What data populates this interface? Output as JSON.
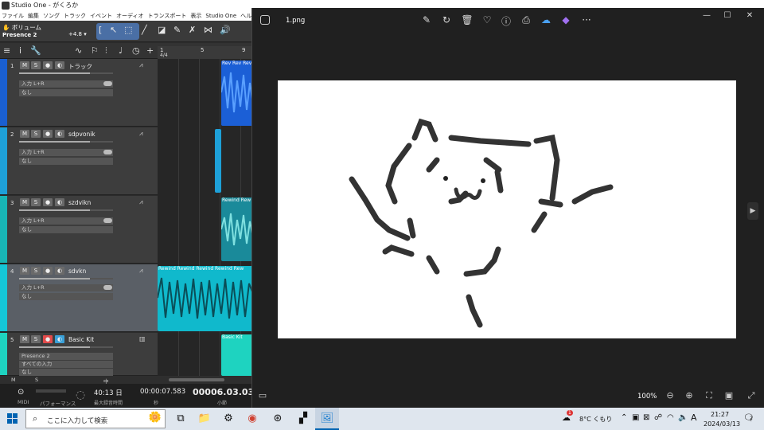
{
  "studio_one": {
    "window_title": "Studio One - がくろか",
    "menu": [
      "ファイル",
      "編集",
      "ソング",
      "トラック",
      "イベント",
      "オーディオ",
      "トランスポート",
      "表示",
      "Studio One",
      "ヘルプ"
    ],
    "toolbar": {
      "mode_label": "ボリューム",
      "preset": "Presence 2",
      "gain": "+4.8"
    },
    "ruler": {
      "marks": [
        "1",
        "5",
        "9"
      ],
      "time_sig": "4/4"
    },
    "tracks": [
      {
        "num": "1",
        "name": "トラック",
        "input": "入力 L+R",
        "output": "なし",
        "color": "#1a5fd1"
      },
      {
        "num": "2",
        "name": "sdpvonik",
        "input": "入力 L+R",
        "output": "なし",
        "color": "#1ea0d8"
      },
      {
        "num": "3",
        "name": "szdvikn",
        "input": "入力 L+R",
        "output": "なし",
        "color": "#18b5b5"
      },
      {
        "num": "4",
        "name": "sdvkn",
        "input": "入力 L+R",
        "output": "なし",
        "color": "#15c6d8"
      },
      {
        "num": "5",
        "name": "Basic Kit",
        "input": "Presence 2",
        "output": "すべての入力",
        "extra": "なし",
        "color": "#1ed3c0"
      }
    ],
    "clips": {
      "t1": "Rev Rev Rev",
      "t3": "Rewind Rew",
      "t4": "Rewind Rewind Rewind Rewind Rew",
      "t5": "Basic Kit"
    },
    "bottom_bar": {
      "m": "M",
      "s": "S",
      "mid": "中"
    },
    "transport": {
      "midi_label": "MIDI",
      "perf_label": "パフォーマンス",
      "record_time": "40:13 日",
      "record_sub": "最大録音時間",
      "time": "00:00:07.583",
      "time_sub": "秒",
      "bars": "00006.03.03.9",
      "bars_sub": "小節"
    }
  },
  "photos": {
    "filename": "1.png",
    "zoom": "100%",
    "image_description": "hand-drawn cat sketch",
    "toolbar_icons": [
      "edit-icon",
      "rotate-icon",
      "delete-icon",
      "favorite-icon",
      "info-icon",
      "print-icon",
      "onedrive-icon",
      "clipchamp-icon",
      "more-icon"
    ]
  },
  "taskbar": {
    "search_placeholder": "ここに入力して検索",
    "weather": "8°C くもり",
    "time": "21:27",
    "date": "2024/03/13",
    "ime": "A",
    "notif_count": "2",
    "weather_badge": "1"
  }
}
